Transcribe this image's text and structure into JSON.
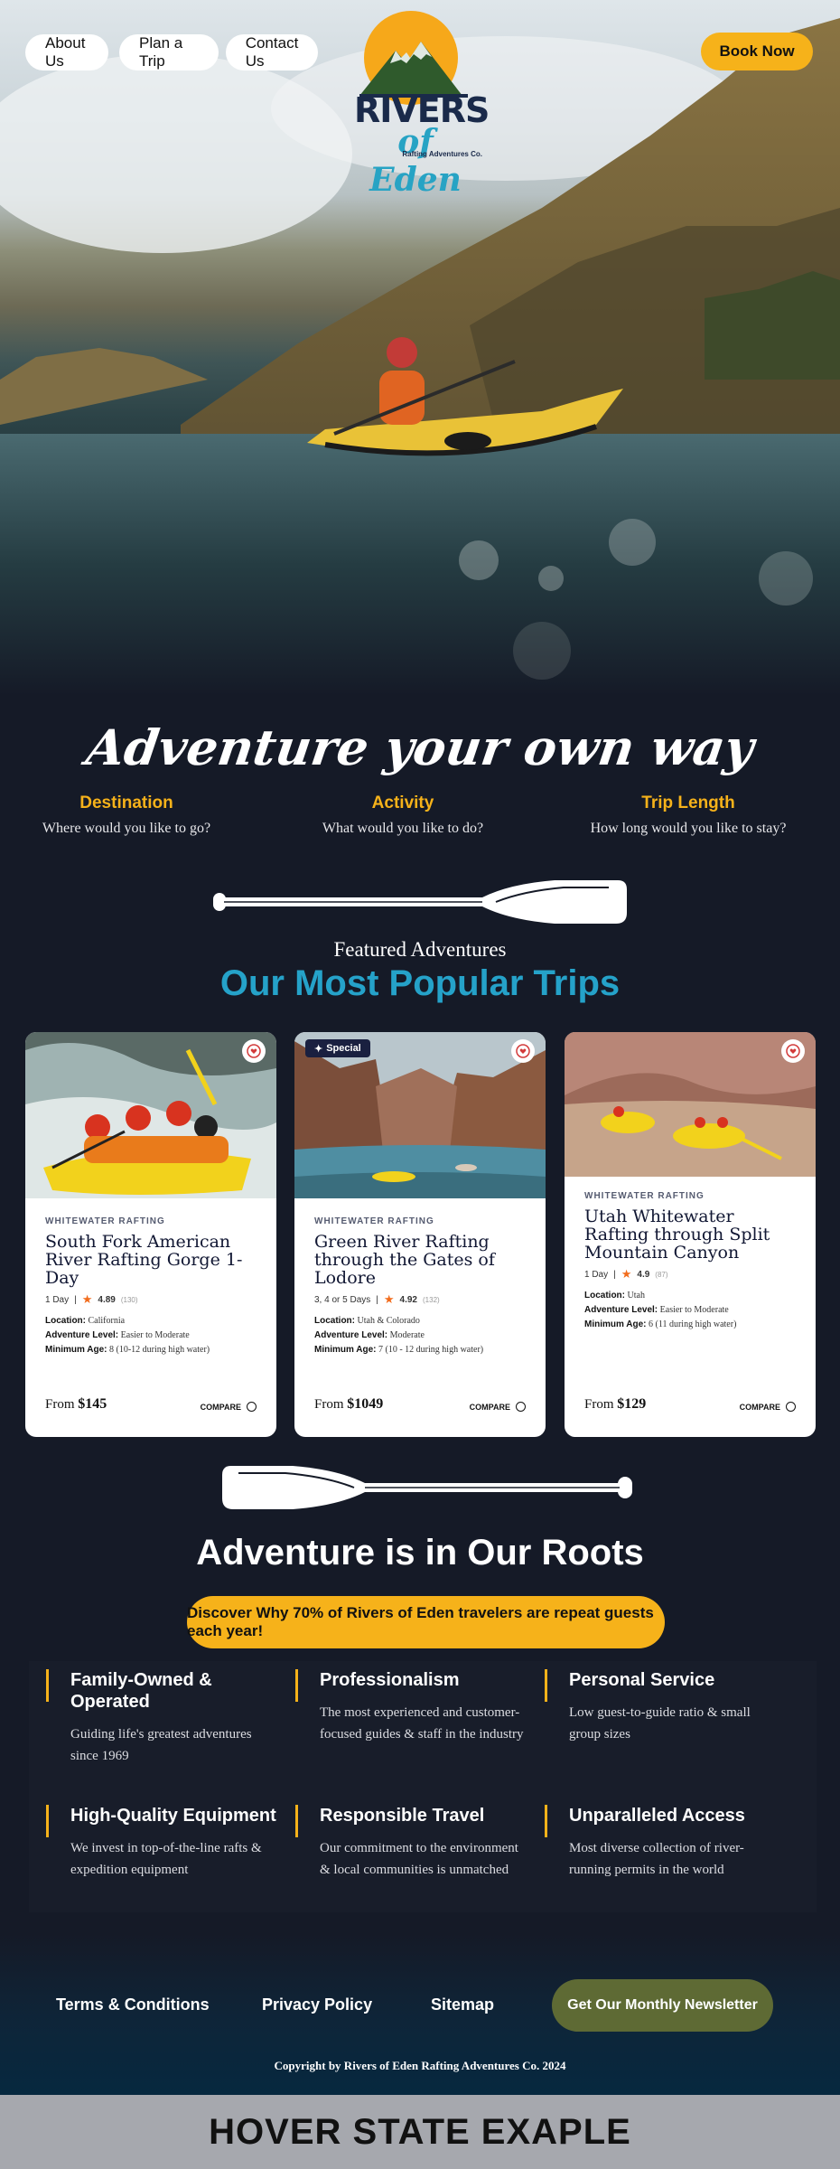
{
  "nav": {
    "about": "About Us",
    "plan": "Plan a Trip",
    "contact": "Contact Us",
    "book": "Book Now"
  },
  "logo": {
    "line1": "RIVERS",
    "line2": "of Eden",
    "line3": "Rafting Adventures Co."
  },
  "tagline": "Adventure your own way",
  "filters": [
    {
      "title": "Destination",
      "prompt": "Where would you like to go?"
    },
    {
      "title": "Activity",
      "prompt": "What would you like to do?"
    },
    {
      "title": "Trip Length",
      "prompt": "How long would you like to stay?"
    }
  ],
  "featured": {
    "kicker": "Featured Adventures",
    "heading": "Our Most Popular Trips"
  },
  "cards": [
    {
      "category": "WHITEWATER RAFTING",
      "name": "South Fork American River Rafting Gorge 1-Day",
      "duration": "1 Day",
      "rating": "4.89",
      "reviews": "(130)",
      "location_label": "Location:",
      "location": "California",
      "level_label": "Adventure Level:",
      "level": "Easier to Moderate",
      "age_label": "Minimum Age:",
      "age": "8 (10-12 during high water)",
      "price_prefix": "From",
      "price": "$145",
      "compare": "COMPARE"
    },
    {
      "badge": "Special",
      "category": "WHITEWATER RAFTING",
      "name": "Green River Rafting through the Gates of Lodore",
      "duration": "3, 4 or 5 Days",
      "rating": "4.92",
      "reviews": "(132)",
      "location_label": "Location:",
      "location": "Utah & Colorado",
      "level_label": "Adventure Level:",
      "level": "Moderate",
      "age_label": "Minimum Age:",
      "age": "7 (10 - 12 during high water)",
      "price_prefix": "From",
      "price": "$1049",
      "compare": "COMPARE"
    },
    {
      "category": "WHITEWATER RAFTING",
      "name": "Utah Whitewater Rafting through Split Mountain Canyon",
      "duration": "1 Day",
      "rating": "4.9",
      "reviews": "(87)",
      "location_label": "Location:",
      "location": "Utah",
      "level_label": "Adventure Level:",
      "level": "Easier to Moderate",
      "age_label": "Minimum Age:",
      "age": "6 (11 during high water)",
      "price_prefix": "From",
      "price": "$129",
      "compare": "COMPARE"
    }
  ],
  "roots": {
    "heading": "Adventure is in Our Roots",
    "cta": "Discover Why 70% of Rivers of Eden travelers are repeat guests each year!"
  },
  "values": [
    {
      "title": "Family-Owned & Operated",
      "desc": "Guiding life's greatest adventures since 1969"
    },
    {
      "title": "Professionalism",
      "desc": "The most experienced and customer-focused guides & staff in the industry"
    },
    {
      "title": "Personal Service",
      "desc": "Low guest-to-guide ratio & small group sizes"
    },
    {
      "title": "High-Quality Equipment",
      "desc": "We invest in top-of-the-line rafts & expedition equipment"
    },
    {
      "title": "Responsible Travel",
      "desc": "Our commitment to the environment & local communities is unmatched"
    },
    {
      "title": "Unparalleled Access",
      "desc": "Most diverse collection of river-running permits in the world"
    }
  ],
  "footer": {
    "terms": "Terms & Conditions",
    "privacy": "Privacy Policy",
    "sitemap": "Sitemap",
    "newsletter": "Get Our Monthly Newsletter",
    "copyright": "Copyright by Rivers of Eden Rafting Adventures Co. 2024"
  },
  "hover_banner": "HOVER STATE EXAPLE",
  "colors": {
    "accent": "#f6b21a",
    "brand_blue": "#25a2c9",
    "background": "#151a27",
    "newsletter": "#5e6a34",
    "star": "#f26c1c"
  },
  "icons": {
    "favorite": "heart-badge-icon",
    "special": "sparkle-icon",
    "rating": "star-icon",
    "divider": "paddle-icon"
  }
}
